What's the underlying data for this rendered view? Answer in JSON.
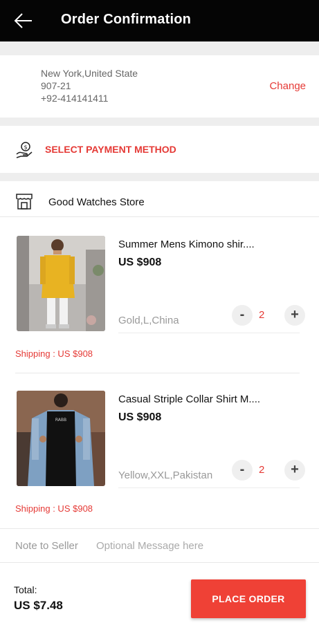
{
  "header": {
    "title": "Order Confirmation",
    "back_icon": "arrow-left-icon",
    "background": "#050505"
  },
  "address": {
    "line1": "New York,United State",
    "line2": "907-21",
    "phone": "+92-414141411",
    "change_label": "Change"
  },
  "payment": {
    "icon": "hand-coin-icon",
    "label": "SELECT PAYMENT METHOD"
  },
  "store": {
    "icon": "store-icon",
    "name": "Good Watches Store"
  },
  "items": [
    {
      "title": "Summer Mens Kimono shir....",
      "price": "US $908",
      "variant": "Gold,L,China",
      "quantity": "2",
      "minus_label": "-",
      "plus_label": "+",
      "shipping": "Shipping : US $908"
    },
    {
      "title": "Casual Striple Collar Shirt M....",
      "price": "US $908",
      "variant": "Yellow,XXL,Pakistan",
      "quantity": "2",
      "minus_label": "-",
      "plus_label": "+",
      "shipping": "Shipping : US $908"
    }
  ],
  "note": {
    "label": "Note to Seller",
    "placeholder": "Optional Message here"
  },
  "footer": {
    "total_label": "Total:",
    "total_value": "US $7.48",
    "place_order_label": "PLACE ORDER"
  },
  "colors": {
    "accent": "#e53935",
    "button": "#ef4136"
  }
}
